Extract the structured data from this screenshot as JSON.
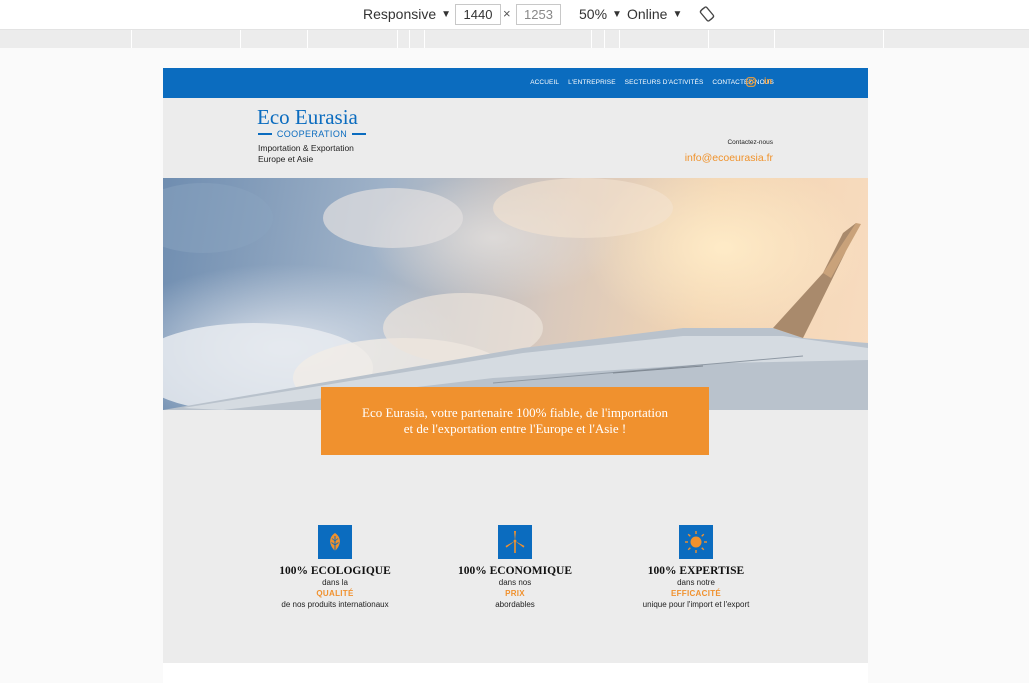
{
  "devtools": {
    "device": "Responsive",
    "width": "1440",
    "height": "1253",
    "separator": "×",
    "zoom": "50%",
    "network": "Online",
    "caret": "▼"
  },
  "nav": {
    "links": [
      "ACCUEIL",
      "L'ENTREPRISE",
      "SECTEURS D'ACTIVITÉS",
      "CONTACTEZ-NOUS"
    ],
    "social": {
      "linkedin": "in"
    },
    "background": "#0b6cbf"
  },
  "brand": {
    "name": "Eco Eurasia",
    "subtitle": "COOPERATION",
    "tagline_line1": "Importation & Exportation",
    "tagline_line2": "Europe et Asie",
    "color": "#0b6cbf"
  },
  "contact": {
    "label": "Contactez-nous",
    "email": "info@ecoeurasia.fr",
    "accent": "#f0912e"
  },
  "hero": {
    "banner_line1": "Eco Eurasia, votre partenaire 100% fiable, de l'importation",
    "banner_line2": "et de l'exportation entre l'Europe et l'Asie !"
  },
  "features": [
    {
      "icon": "leaf-icon",
      "title": "100% ECOLOGIQUE",
      "line1": "dans la",
      "highlight": "QUALITÉ",
      "line2": "de nos produits internationaux"
    },
    {
      "icon": "wind-turbine-icon",
      "title": "100% ECONOMIQUE",
      "line1": "dans nos",
      "highlight": "PRIX",
      "line2": "abordables"
    },
    {
      "icon": "sun-icon",
      "title": "100% EXPERTISE",
      "line1": "dans notre",
      "highlight": "EFFICACITÉ",
      "line2": "unique pour l'import et l'export"
    }
  ]
}
